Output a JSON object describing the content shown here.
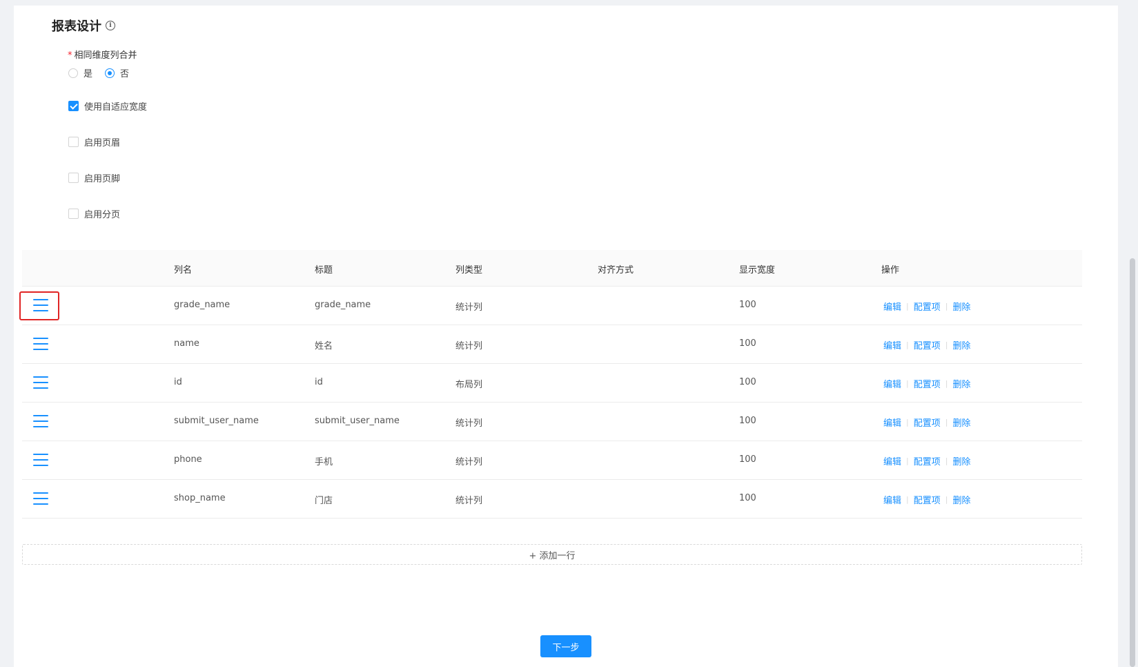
{
  "section": {
    "title": "报表设计",
    "info_icon": "i"
  },
  "merge": {
    "label": "相同维度列合并",
    "required_mark": "*",
    "options": [
      {
        "label": "是",
        "checked": false
      },
      {
        "label": "否",
        "checked": true
      }
    ]
  },
  "checkboxes": [
    {
      "label": "使用自适应宽度",
      "checked": true
    },
    {
      "label": "启用页眉",
      "checked": false
    },
    {
      "label": "启用页脚",
      "checked": false
    },
    {
      "label": "启用分页",
      "checked": false
    }
  ],
  "table": {
    "headers": [
      "列名",
      "标题",
      "列类型",
      "对齐方式",
      "显示宽度",
      "操作"
    ],
    "actions": {
      "edit": "编辑",
      "config": "配置项",
      "delete": "删除",
      "sep": "|"
    },
    "rows": [
      {
        "name": "grade_name",
        "title": "grade_name",
        "type": "统计列",
        "align": "",
        "width": "100"
      },
      {
        "name": "name",
        "title": "姓名",
        "type": "统计列",
        "align": "",
        "width": "100"
      },
      {
        "name": "id",
        "title": "id",
        "type": "布局列",
        "align": "",
        "width": "100"
      },
      {
        "name": "submit_user_name",
        "title": "submit_user_name",
        "type": "统计列",
        "align": "",
        "width": "100"
      },
      {
        "name": "phone",
        "title": "手机",
        "type": "统计列",
        "align": "",
        "width": "100"
      },
      {
        "name": "shop_name",
        "title": "门店",
        "type": "统计列",
        "align": "",
        "width": "100"
      }
    ]
  },
  "add_row": {
    "label": "+ 添加一行"
  },
  "footer": {
    "next_label": "下一步"
  },
  "colors": {
    "accent": "#1890ff",
    "highlight": "#e02424",
    "required": "#f5222d"
  }
}
